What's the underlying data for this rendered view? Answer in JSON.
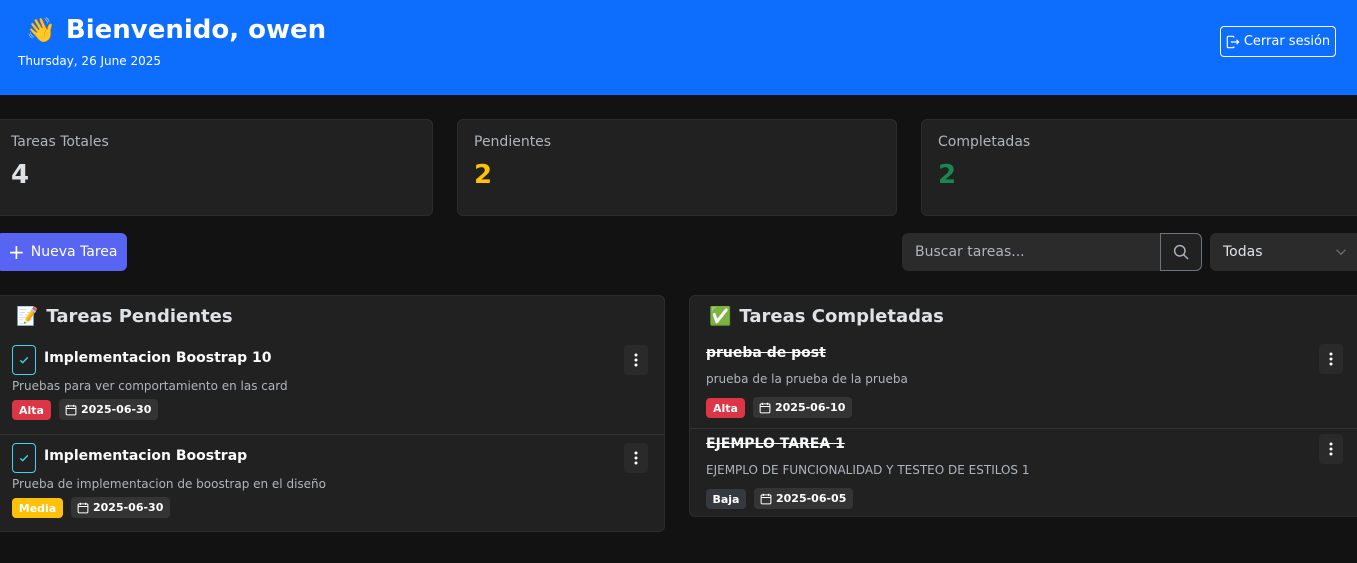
{
  "header": {
    "wave": "👋",
    "greeting": "Bienvenido, owen",
    "date": "Thursday, 26 June 2025",
    "logout_label": "Cerrar sesión"
  },
  "stats": {
    "total": {
      "label": "Tareas Totales",
      "value": "4",
      "color": "#dee2e6"
    },
    "pending": {
      "label": "Pendientes",
      "value": "2",
      "color": "#ffc107"
    },
    "completed": {
      "label": "Completadas",
      "value": "2",
      "color": "#198754"
    }
  },
  "toolbar": {
    "new_task_label": "Nueva Tarea",
    "search_placeholder": "Buscar tareas...",
    "filter_value": "Todas"
  },
  "pending_panel": {
    "icon": "📝",
    "title": "Tareas Pendientes",
    "tasks": [
      {
        "title": "Implementacion Boostrap 10",
        "description": "Pruebas para ver comportamiento en las card",
        "priority": "Alta",
        "due": "2025-06-30"
      },
      {
        "title": "Implementacion Boostrap",
        "description": "Prueba de implementacion de boostrap en el diseño",
        "priority": "Media",
        "due": "2025-06-30"
      }
    ]
  },
  "completed_panel": {
    "icon": "✅",
    "title": "Tareas Completadas",
    "tasks": [
      {
        "title": "prueba de post",
        "description": "prueba de la prueba de la prueba",
        "priority": "Alta",
        "due": "2025-06-10"
      },
      {
        "title": "EJEMPLO TAREA 1",
        "description": "EJEMPLO DE FUNCIONALIDAD Y TESTEO DE ESTILOS 1",
        "priority": "Baja",
        "due": "2025-06-05"
      }
    ]
  },
  "colors": {
    "header_bg": "#0d6efd",
    "page_bg": "#121212",
    "card_bg": "#212121",
    "accent_button": "#5865f2",
    "priority_alta": "#dc3545",
    "priority_media": "#ffc107",
    "priority_baja": "#343a40"
  },
  "icons": {
    "logout": "box-arrow-right-icon",
    "plus": "plus-icon",
    "search": "search-icon",
    "chevron": "chevron-down-icon",
    "check": "check-icon",
    "calendar": "calendar-icon",
    "menu": "three-dots-vertical-icon"
  }
}
